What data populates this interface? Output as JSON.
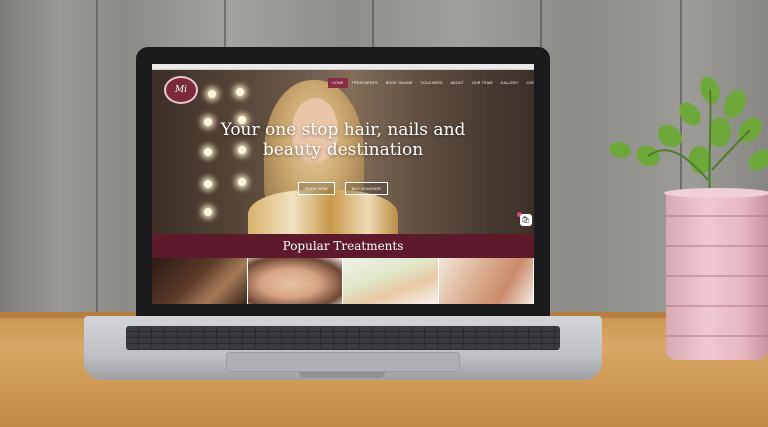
{
  "site": {
    "logo_text": "Mi",
    "nav": [
      "HOME",
      "TREATMENTS",
      "BOOK ONLINE",
      "VOUCHERS",
      "ABOUT",
      "OUR TEAM",
      "GALLERY",
      "CONTACT"
    ],
    "nav_caret": "▾",
    "headline": "Your one stop hair, nails and beauty destination",
    "cta_primary": "BOOK NOW",
    "cta_secondary": "BUY VOUCHER",
    "basket_icon": "🛍",
    "section_title": "Popular Treatments"
  },
  "colors": {
    "brand": "#5c1a2b",
    "nav_active": "#8a2c44"
  }
}
